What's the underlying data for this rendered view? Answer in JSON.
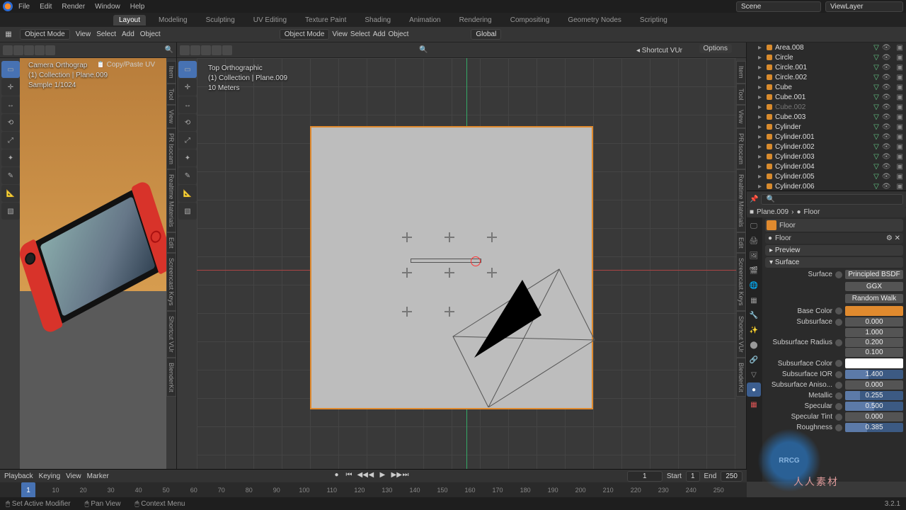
{
  "menu": {
    "file": "File",
    "edit": "Edit",
    "render": "Render",
    "window": "Window",
    "help": "Help"
  },
  "workspaces": [
    "Layout",
    "Modeling",
    "Sculpting",
    "UV Editing",
    "Texture Paint",
    "Shading",
    "Animation",
    "Rendering",
    "Compositing",
    "Geometry Nodes",
    "Scripting"
  ],
  "active_workspace": "Layout",
  "scene_field": "Scene",
  "viewlayer_field": "ViewLayer",
  "header": {
    "mode": "Object Mode",
    "view": "View",
    "select": "Select",
    "add": "Add",
    "object": "Object",
    "orientation": "Global"
  },
  "viewport_left": {
    "title": "Camera Orthograp",
    "addon": "Copy/Paste UV",
    "collection": "(1) Collection | Plane.009",
    "sample": "Sample 1/1024"
  },
  "viewport_center": {
    "title": "Top Orthographic",
    "collection": "(1) Collection | Plane.009",
    "scale": "10 Meters",
    "options": "Options",
    "shortcut": "Shortcut VUr"
  },
  "sidebar_tabs": [
    "Item",
    "Tool",
    "View",
    "PR Isocam",
    "Realtime Materials",
    "Edit",
    "Screencast Keys",
    "Shortcut VUr",
    "BlenderKit"
  ],
  "outliner": [
    {
      "name": "Area.008",
      "dim": false
    },
    {
      "name": "Circle",
      "dim": false
    },
    {
      "name": "Circle.001",
      "dim": false
    },
    {
      "name": "Circle.002",
      "dim": false
    },
    {
      "name": "Cube",
      "dim": false
    },
    {
      "name": "Cube.001",
      "dim": false
    },
    {
      "name": "Cube.002",
      "dim": true
    },
    {
      "name": "Cube.003",
      "dim": false
    },
    {
      "name": "Cylinder",
      "dim": false
    },
    {
      "name": "Cylinder.001",
      "dim": false
    },
    {
      "name": "Cylinder.002",
      "dim": false
    },
    {
      "name": "Cylinder.003",
      "dim": false
    },
    {
      "name": "Cylinder.004",
      "dim": false
    },
    {
      "name": "Cylinder.005",
      "dim": false
    },
    {
      "name": "Cylinder.006",
      "dim": false
    }
  ],
  "props": {
    "object": "Plane.009",
    "material": "Floor",
    "preview": "Preview",
    "surface_panel": "Surface",
    "surface_label": "Surface",
    "shader": "Principled BSDF",
    "distribution": "GGX",
    "subsurf_method": "Random Walk",
    "rows": [
      {
        "label": "Base Color",
        "type": "color",
        "value": "#e08a2e"
      },
      {
        "label": "Subsurface",
        "type": "num",
        "value": "0.000"
      },
      {
        "label": "Subsurface Radius",
        "type": "multi",
        "values": [
          "1.000",
          "0.200",
          "0.100"
        ]
      },
      {
        "label": "Subsurface Color",
        "type": "color",
        "value": "#ffffff"
      },
      {
        "label": "Subsurface IOR",
        "type": "drag",
        "value": "1.400",
        "fill": 40
      },
      {
        "label": "Subsurface Aniso...",
        "type": "num",
        "value": "0.000"
      },
      {
        "label": "Metallic",
        "type": "drag",
        "value": "0.255",
        "fill": 26
      },
      {
        "label": "Specular",
        "type": "drag",
        "value": "0.500",
        "fill": 50
      },
      {
        "label": "Specular Tint",
        "type": "num",
        "value": "0.000"
      },
      {
        "label": "Roughness",
        "type": "drag",
        "value": "0.385",
        "fill": 38
      }
    ]
  },
  "timeline": {
    "playback": "Playback",
    "keying": "Keying",
    "view": "View",
    "marker": "Marker",
    "frames": [
      "1",
      "10",
      "20",
      "30",
      "40",
      "50",
      "60",
      "70",
      "80",
      "90",
      "100",
      "110",
      "120",
      "130",
      "140",
      "150",
      "160",
      "170",
      "180",
      "190",
      "200",
      "210",
      "220",
      "230",
      "240",
      "250"
    ],
    "current": "1",
    "start_label": "Start",
    "start": "1",
    "end_label": "End",
    "end": "250",
    "frame_field": "1"
  },
  "statusbar": {
    "modifier": "Set Active Modifier",
    "pan": "Pan View",
    "context": "Context Menu",
    "version": "3.2.1"
  },
  "watermark": {
    "logo": "RRCG",
    "sub": "人人素材"
  }
}
